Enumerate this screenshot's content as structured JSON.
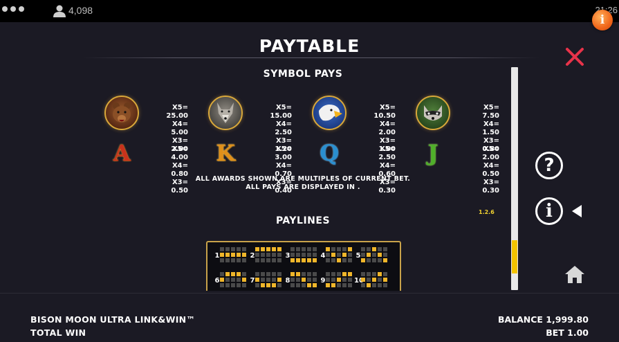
{
  "status_bar": {
    "player_count": "4,098",
    "time": "21:26"
  },
  "page": {
    "title": "PAYTABLE",
    "section_symbol_pays": "SYMBOL PAYS",
    "section_paylines": "PAYLINES"
  },
  "symbols": [
    {
      "id": "bear",
      "icon": "bear-icon",
      "pays": [
        "X5= 25.00",
        "X4= 5.00",
        "X3= 2.00"
      ]
    },
    {
      "id": "wolf",
      "icon": "wolf-icon",
      "pays": [
        "X5= 15.00",
        "X4= 2.50",
        "X3= 1.20"
      ]
    },
    {
      "id": "eagle",
      "icon": "eagle-icon",
      "pays": [
        "X5= 10.50",
        "X4= 2.00",
        "X3= 1.00"
      ]
    },
    {
      "id": "raccoon",
      "icon": "raccoon-icon",
      "pays": [
        "X5= 7.50",
        "X4= 1.50",
        "X3= 0.80"
      ]
    },
    {
      "id": "A",
      "label": "A",
      "color": "#c8321c",
      "pays": [
        "X5= 4.00",
        "X4= 0.80",
        "X3= 0.50"
      ]
    },
    {
      "id": "K",
      "label": "K",
      "color": "#e0901a",
      "pays": [
        "X5= 3.00",
        "X4= 0.70",
        "X3= 0.40"
      ]
    },
    {
      "id": "Q",
      "label": "Q",
      "color": "#2a8fd0",
      "pays": [
        "X5= 2.50",
        "X4= 0.60",
        "X3= 0.30"
      ]
    },
    {
      "id": "J",
      "label": "J",
      "color": "#4fb02a",
      "pays": [
        "X5= 2.00",
        "X4= 0.50",
        "X3= 0.30"
      ]
    }
  ],
  "notes": {
    "line1": "ALL AWARDS SHOWN ARE MULTIPLES OF CURRENT BET.",
    "line2": "ALL PAYS ARE DISPLAYED IN ."
  },
  "version": "1.2.6",
  "paylines": [
    {
      "n": "1",
      "rows": [
        1,
        1,
        1,
        1,
        1
      ]
    },
    {
      "n": "2",
      "rows": [
        0,
        0,
        0,
        0,
        0
      ]
    },
    {
      "n": "3",
      "rows": [
        2,
        2,
        2,
        2,
        2
      ]
    },
    {
      "n": "4",
      "rows": [
        0,
        1,
        2,
        1,
        0
      ]
    },
    {
      "n": "5",
      "rows": [
        2,
        1,
        0,
        1,
        2
      ]
    },
    {
      "n": "6",
      "rows": [
        1,
        0,
        0,
        0,
        1
      ]
    },
    {
      "n": "7",
      "rows": [
        1,
        2,
        2,
        2,
        1
      ]
    },
    {
      "n": "8",
      "rows": [
        0,
        0,
        1,
        2,
        2
      ]
    },
    {
      "n": "9",
      "rows": [
        2,
        2,
        1,
        0,
        0
      ]
    },
    {
      "n": "10",
      "rows": [
        1,
        2,
        1,
        0,
        1
      ]
    }
  ],
  "scroll": {
    "position_fraction": 0.78
  },
  "footer": {
    "game_name": "BISON MOON ULTRA LINK&WIN™",
    "total_win_label": "TOTAL WIN",
    "balance": "BALANCE 1,999.80",
    "bet": "BET 1.00"
  },
  "colors": {
    "accent_gold": "#c9a34a",
    "close_red": "#e8334a",
    "scroll_yellow": "#f2c300",
    "info_orange": "#f1661a"
  }
}
